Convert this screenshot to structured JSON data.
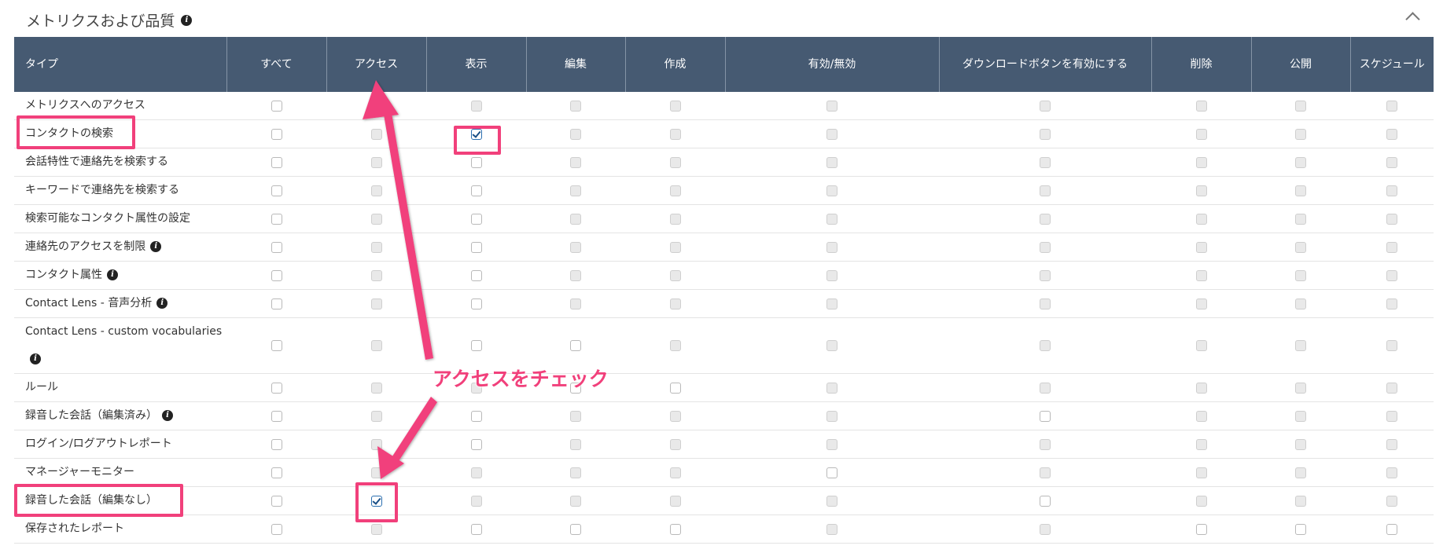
{
  "panel": {
    "title": "メトリクスおよび品質",
    "info_icon": "info-icon",
    "collapse_icon": "chevron-up-icon"
  },
  "table": {
    "columns": [
      "タイプ",
      "すべて",
      "アクセス",
      "表示",
      "編集",
      "作成",
      "有効/無効",
      "ダウンロードボタンを有効にする",
      "削除",
      "公開",
      "スケジュール"
    ],
    "rows": [
      {
        "label": "メトリクスへのアクセス",
        "info": false,
        "cells": [
          "e",
          "d",
          "d",
          "d",
          "d",
          "d",
          "d",
          "d",
          "d",
          "d"
        ]
      },
      {
        "label": "コンタクトの検索",
        "info": false,
        "cells": [
          "e",
          "d",
          "c",
          "d",
          "d",
          "d",
          "d",
          "d",
          "d",
          "d"
        ]
      },
      {
        "label": "会話特性で連絡先を検索する",
        "info": false,
        "cells": [
          "e",
          "d",
          "e",
          "d",
          "d",
          "d",
          "d",
          "d",
          "d",
          "d"
        ]
      },
      {
        "label": "キーワードで連絡先を検索する",
        "info": false,
        "cells": [
          "e",
          "d",
          "e",
          "d",
          "d",
          "d",
          "d",
          "d",
          "d",
          "d"
        ]
      },
      {
        "label": "検索可能なコンタクト属性の設定",
        "info": false,
        "cells": [
          "e",
          "d",
          "e",
          "d",
          "d",
          "d",
          "d",
          "d",
          "d",
          "d"
        ]
      },
      {
        "label": "連絡先のアクセスを制限",
        "info": true,
        "cells": [
          "e",
          "d",
          "e",
          "d",
          "d",
          "d",
          "d",
          "d",
          "d",
          "d"
        ]
      },
      {
        "label": "コンタクト属性",
        "info": true,
        "cells": [
          "e",
          "d",
          "e",
          "d",
          "d",
          "d",
          "d",
          "d",
          "d",
          "d"
        ]
      },
      {
        "label": "Contact Lens - 音声分析",
        "info": true,
        "cells": [
          "e",
          "d",
          "e",
          "d",
          "d",
          "d",
          "d",
          "d",
          "d",
          "d"
        ]
      },
      {
        "label": "Contact Lens - custom vocabularies",
        "info": true,
        "tall": true,
        "cells": [
          "e",
          "d",
          "e",
          "e",
          "d",
          "d",
          "d",
          "d",
          "d",
          "d"
        ]
      },
      {
        "label": "ルール",
        "info": false,
        "cells": [
          "e",
          "d",
          "d",
          "e",
          "e",
          "d",
          "d",
          "d",
          "d",
          "d"
        ]
      },
      {
        "label": "録音した会話（編集済み）",
        "info": true,
        "cells": [
          "e",
          "d",
          "e",
          "d",
          "d",
          "d",
          "e",
          "d",
          "d",
          "d"
        ]
      },
      {
        "label": "ログイン/ログアウトレポート",
        "info": false,
        "cells": [
          "e",
          "d",
          "e",
          "d",
          "d",
          "d",
          "d",
          "d",
          "d",
          "d"
        ]
      },
      {
        "label": "マネージャーモニター",
        "info": false,
        "cells": [
          "e",
          "d",
          "d",
          "d",
          "d",
          "e",
          "d",
          "d",
          "d",
          "d"
        ]
      },
      {
        "label": "録音した会話（編集なし）",
        "info": false,
        "cells": [
          "e",
          "c",
          "d",
          "d",
          "d",
          "d",
          "e",
          "d",
          "d",
          "d"
        ]
      },
      {
        "label": "保存されたレポート",
        "info": false,
        "cells": [
          "e",
          "d",
          "e",
          "e",
          "e",
          "d",
          "d",
          "e",
          "e",
          "e"
        ]
      }
    ]
  },
  "annotation": {
    "callout": "アクセスをチェック",
    "accent_color": "#f1407b"
  }
}
